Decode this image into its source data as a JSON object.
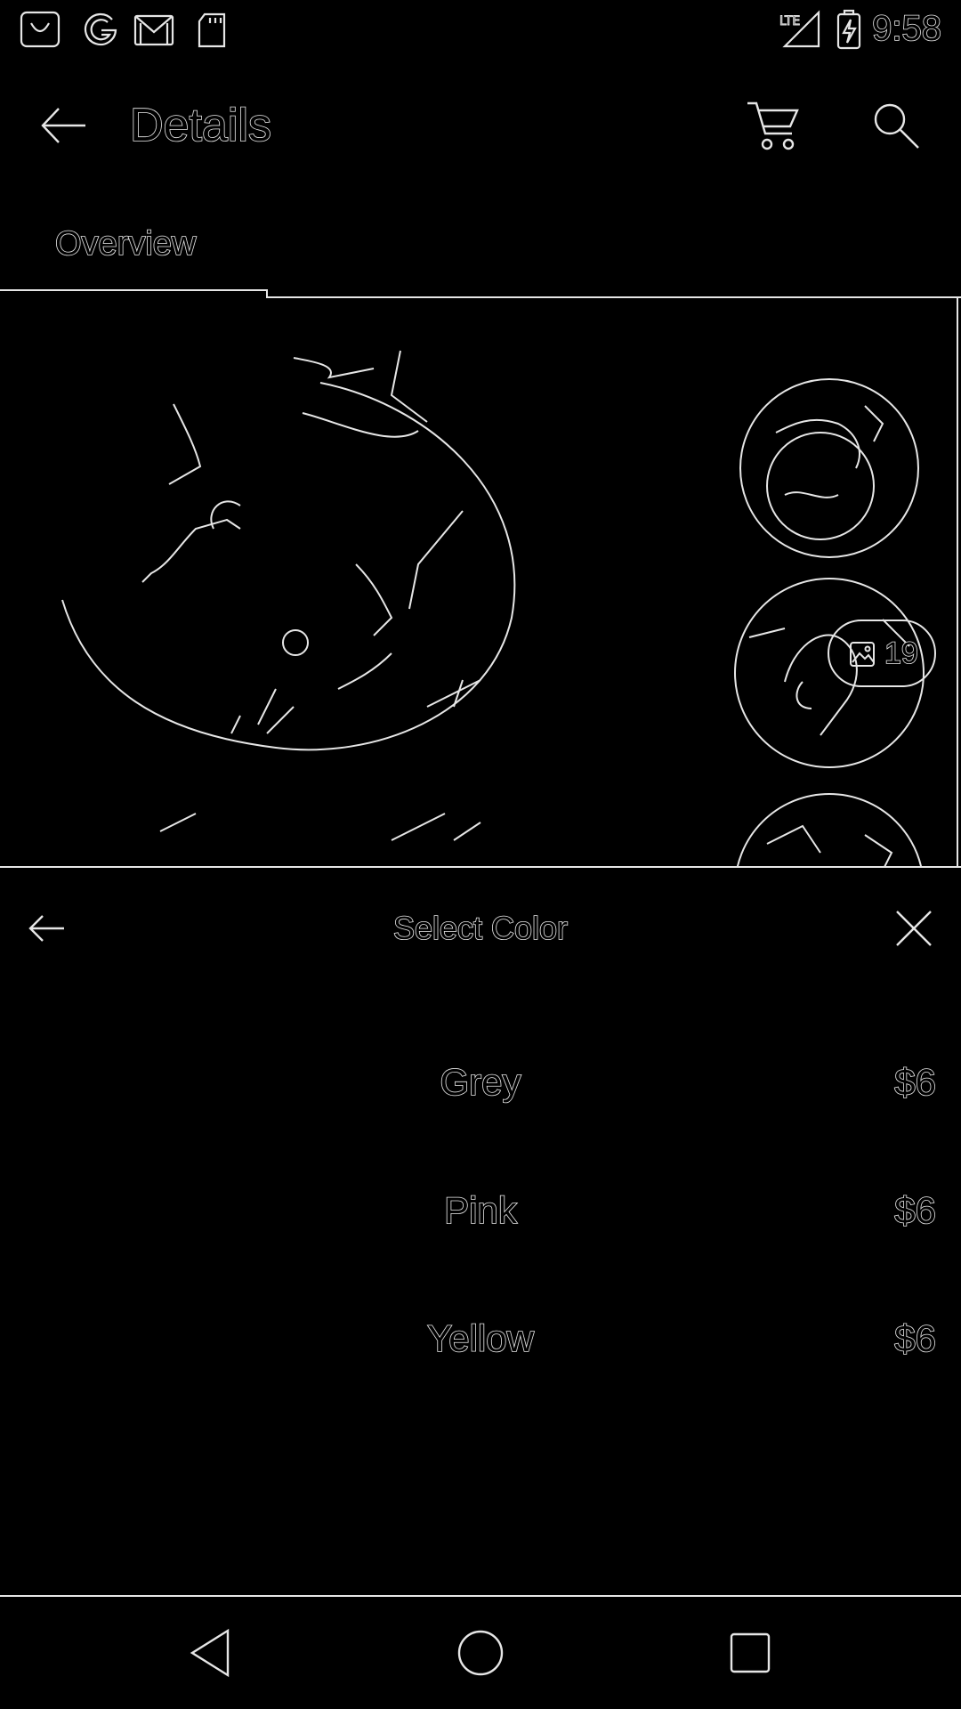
{
  "status_bar": {
    "time": "9:58",
    "icons": [
      "shopping-bag-icon",
      "google-icon",
      "gmail-icon",
      "sd-card-icon",
      "lte-signal-icon",
      "battery-charging-icon"
    ]
  },
  "app_bar": {
    "title": "Details",
    "icons": [
      "back-arrow-icon",
      "cart-icon",
      "search-icon"
    ]
  },
  "tabs": [
    {
      "label": "Overview",
      "active": true
    }
  ],
  "gallery": {
    "photo_count": "19",
    "photo_count_icon": "image-icon",
    "thumbnail_count_visible": 3
  },
  "color_sheet": {
    "title": "Select Color",
    "back_icon": "back-arrow-icon",
    "close_icon": "close-icon",
    "options": [
      {
        "name": "Grey",
        "price": "$6"
      },
      {
        "name": "Pink",
        "price": "$6"
      },
      {
        "name": "Yellow",
        "price": "$6"
      }
    ]
  },
  "nav_bar": {
    "icons": [
      "nav-back-icon",
      "nav-home-icon",
      "nav-recents-icon"
    ]
  },
  "colors": {
    "background": "#000000",
    "line": "#e6e6e6"
  }
}
